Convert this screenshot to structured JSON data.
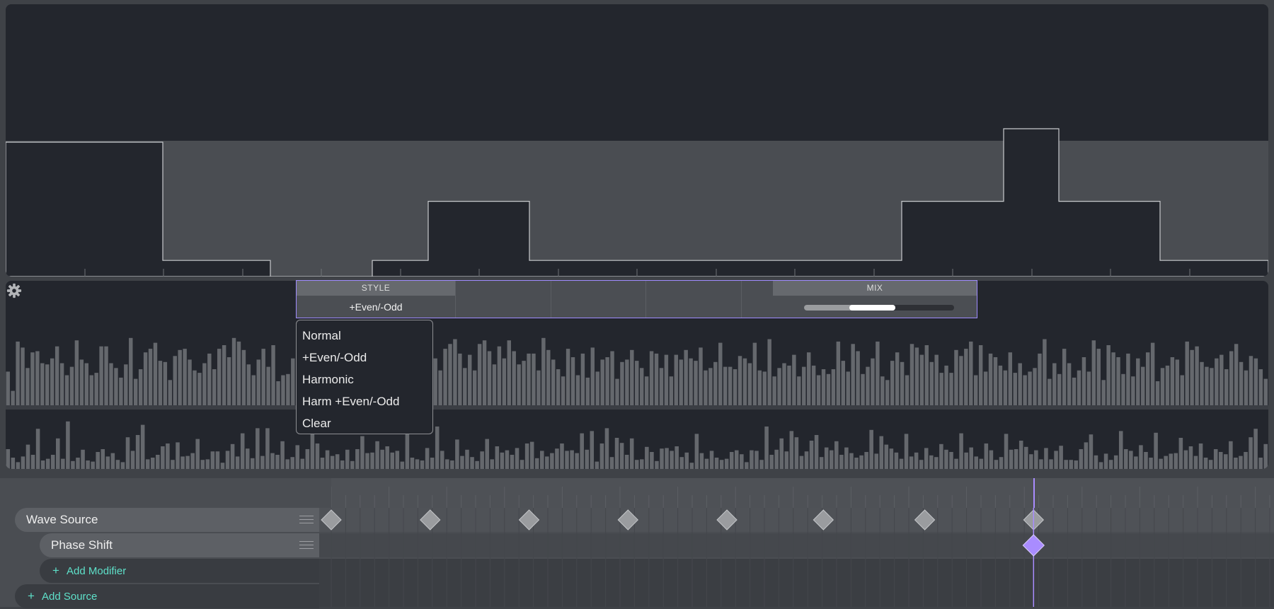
{
  "wavetable": {
    "steps": [
      {
        "level": 1.0,
        "width": 222
      },
      {
        "level": 0.12,
        "width": 152
      },
      {
        "level": 0.0,
        "width": 144
      },
      {
        "level": 0.12,
        "width": 79
      },
      {
        "level": 0.56,
        "width": 143
      },
      {
        "level": 0.12,
        "width": 526
      },
      {
        "level": 0.56,
        "width": 144
      },
      {
        "level": 1.1,
        "width": 78
      },
      {
        "level": 0.56,
        "width": 143
      },
      {
        "level": 0.12,
        "width": 153
      }
    ]
  },
  "spectrum": {
    "top_bars": [
      0.28,
      0.12,
      0.53,
      0.48,
      0.31,
      0.44,
      0.45,
      0.35,
      0.34,
      0.39,
      0.49,
      0.35,
      0.25,
      0.32,
      0.54,
      0.38,
      0.35,
      0.25,
      0.27,
      0.49,
      0.49,
      0.35,
      0.31,
      0.23,
      0.34,
      0.56,
      0.22,
      0.3,
      0.44,
      0.47,
      0.52,
      0.37,
      0.36,
      0.21,
      0.41,
      0.46,
      0.47,
      0.38,
      0.29,
      0.27,
      0.35,
      0.43,
      0.3,
      0.47,
      0.5,
      0.4,
      0.56,
      0.53,
      0.46,
      0.34,
      0.25,
      0.38,
      0.47,
      0.32,
      0.5,
      0.2,
      0.25,
      0.26,
      0.39,
      0.28,
      0.47,
      0.31,
      0.28,
      0.36,
      0.53,
      0.33,
      0.35,
      0.54,
      0.26,
      0.4,
      0.31,
      0.35,
      0.39,
      0.33,
      0.49,
      0.22,
      0.43,
      0.36,
      0.38,
      0.33,
      0.41,
      0.38,
      0.51,
      0.23,
      0.23,
      0.45,
      0.47,
      0.39,
      0.29,
      0.47,
      0.51,
      0.55,
      0.43,
      0.31,
      0.42,
      0.29,
      0.51,
      0.54,
      0.45,
      0.34,
      0.49,
      0.39,
      0.54,
      0.45,
      0.34,
      0.37,
      0.43,
      0.43,
      0.29,
      0.56,
      0.46,
      0.38,
      0.3,
      0.24,
      0.47,
      0.4,
      0.25,
      0.43,
      0.23,
      0.48,
      0.28,
      0.38,
      0.4,
      0.45,
      0.22,
      0.36,
      0.38,
      0.46,
      0.37,
      0.31,
      0.24,
      0.45,
      0.43,
      0.31,
      0.42,
      0.24,
      0.42,
      0.38,
      0.46,
      0.39,
      0.37,
      0.48,
      0.29,
      0.31,
      0.36,
      0.52,
      0.32,
      0.32,
      0.3,
      0.41,
      0.39,
      0.35,
      0.52,
      0.29,
      0.28,
      0.55,
      0.24,
      0.31,
      0.35,
      0.33,
      0.42,
      0.24,
      0.32,
      0.44,
      0.33,
      0.25,
      0.3,
      0.26,
      0.3,
      0.53,
      0.37,
      0.28,
      0.51,
      0.45,
      0.26,
      0.32,
      0.39,
      0.53,
      0.24,
      0.21,
      0.37,
      0.44,
      0.36,
      0.25,
      0.51,
      0.48,
      0.42,
      0.5,
      0.36,
      0.42,
      0.27,
      0.33,
      0.27,
      0.46,
      0.41,
      0.47,
      0.53,
      0.25,
      0.5,
      0.28,
      0.43,
      0.4,
      0.33,
      0.29,
      0.44,
      0.27,
      0.35,
      0.25,
      0.28,
      0.31,
      0.43,
      0.55,
      0.22,
      0.35,
      0.26,
      0.47,
      0.35,
      0.23,
      0.29,
      0.4,
      0.28,
      0.54,
      0.47,
      0.21,
      0.5,
      0.44,
      0.4,
      0.26,
      0.43,
      0.24,
      0.39,
      0.32,
      0.44,
      0.52,
      0.2,
      0.31,
      0.33,
      0.4,
      0.38,
      0.25,
      0.53,
      0.46,
      0.49,
      0.36,
      0.32,
      0.31,
      0.39,
      0.42,
      0.3,
      0.45,
      0.51,
      0.36,
      0.29,
      0.41,
      0.39,
      0.3,
      0.22
    ],
    "bottom_bars": [
      0.35,
      0.2,
      0.12,
      0.22,
      0.43,
      0.25,
      0.71,
      0.15,
      0.18,
      0.25,
      0.54,
      0.18,
      0.84,
      0.14,
      0.2,
      0.34,
      0.15,
      0.13,
      0.3,
      0.35,
      0.22,
      0.28,
      0.16,
      0.12,
      0.56,
      0.32,
      0.6,
      0.78,
      0.17,
      0.2,
      0.25,
      0.4,
      0.45,
      0.16,
      0.47,
      0.22,
      0.23,
      0.28,
      0.53,
      0.16,
      0.17,
      0.31,
      0.31,
      0.11,
      0.32,
      0.44,
      0.22,
      0.63,
      0.36,
      0.19,
      0.72,
      0.23,
      0.72,
      0.28,
      0.25,
      0.49,
      0.17,
      0.21,
      0.42,
      0.18,
      0.35,
      0.67,
      0.45,
      0.2,
      0.33,
      0.23,
      0.26,
      0.15,
      0.34,
      0.14,
      0.35,
      0.58,
      0.28,
      0.29,
      0.49,
      0.34,
      0.4,
      0.29,
      0.32,
      0.13,
      0.64,
      0.2,
      0.17,
      0.15,
      0.37,
      0.2,
      0.75,
      0.32,
      0.17,
      0.15,
      0.52,
      0.23,
      0.34,
      0.21,
      0.14,
      0.31,
      0.53,
      0.17,
      0.4,
      0.29,
      0.33,
      0.25,
      0.37,
      0.16,
      0.45,
      0.48,
      0.19,
      0.32,
      0.22,
      0.28,
      0.36,
      0.45,
      0.32,
      0.33,
      0.28,
      0.63,
      0.34,
      0.67,
      0.13,
      0.45,
      0.72,
      0.21,
      0.55,
      0.46,
      0.25,
      0.54,
      0.16,
      0.17,
      0.39,
      0.3,
      0.14,
      0.36,
      0.37,
      0.32,
      0.4,
      0.21,
      0.29,
      0.11,
      0.62,
      0.28,
      0.18,
      0.32,
      0.2,
      0.16,
      0.18,
      0.3,
      0.33,
      0.26,
      0.12,
      0.33,
      0.32,
      0.16,
      0.75,
      0.25,
      0.34,
      0.54,
      0.31,
      0.67,
      0.56,
      0.23,
      0.31,
      0.5,
      0.6,
      0.21,
      0.38,
      0.33,
      0.49,
      0.25,
      0.38,
      0.28,
      0.2,
      0.24,
      0.3,
      0.69,
      0.27,
      0.58,
      0.43,
      0.36,
      0.29,
      0.18,
      0.62,
      0.22,
      0.29,
      0.16,
      0.37,
      0.24,
      0.21,
      0.44,
      0.34,
      0.3,
      0.18,
      0.63,
      0.29,
      0.38,
      0.22,
      0.18,
      0.45,
      0.33,
      0.16,
      0.21,
      0.62,
      0.34,
      0.35,
      0.5,
      0.39,
      0.26,
      0.33,
      0.17,
      0.37,
      0.17,
      0.32,
      0.41,
      0.16,
      0.16,
      0.15,
      0.35,
      0.47,
      0.61,
      0.24,
      0.12,
      0.27,
      0.16,
      0.24,
      0.67,
      0.35,
      0.32,
      0.22,
      0.42,
      0.3,
      0.2,
      0.64,
      0.18,
      0.23,
      0.27,
      0.28,
      0.55,
      0.33,
      0.4,
      0.23,
      0.45,
      0.2,
      0.16,
      0.35,
      0.3,
      0.26,
      0.49,
      0.2,
      0.23,
      0.3,
      0.56,
      0.71,
      0.2,
      0.44
    ]
  },
  "settings": {
    "style_header": "STYLE",
    "style_value": "+Even/-Odd",
    "mix_header": "MIX",
    "mix_range": [
      0.3,
      0.61
    ]
  },
  "style_menu": {
    "options": [
      "Normal",
      "+Even/-Odd",
      "Harmonic",
      "Harm +Even/-Odd",
      "Clear"
    ]
  },
  "timeline": {
    "sources": [
      {
        "name": "Wave Source",
        "modifiers": [
          {
            "name": "Phase Shift"
          }
        ]
      }
    ],
    "add_modifier_label": "Add Modifier",
    "add_source_label": "Add Source",
    "source_keyframes": [
      0.0,
      0.8,
      1.6,
      2.4,
      3.2,
      3.98,
      4.8,
      5.68
    ],
    "modifier_keyframes": [
      5.68
    ],
    "playhead": 5.68,
    "frame_span": 7.55
  },
  "colors": {
    "accent": "#a98cff",
    "add_text": "#5ee0c9",
    "keyframe": "#9a9c9f"
  }
}
